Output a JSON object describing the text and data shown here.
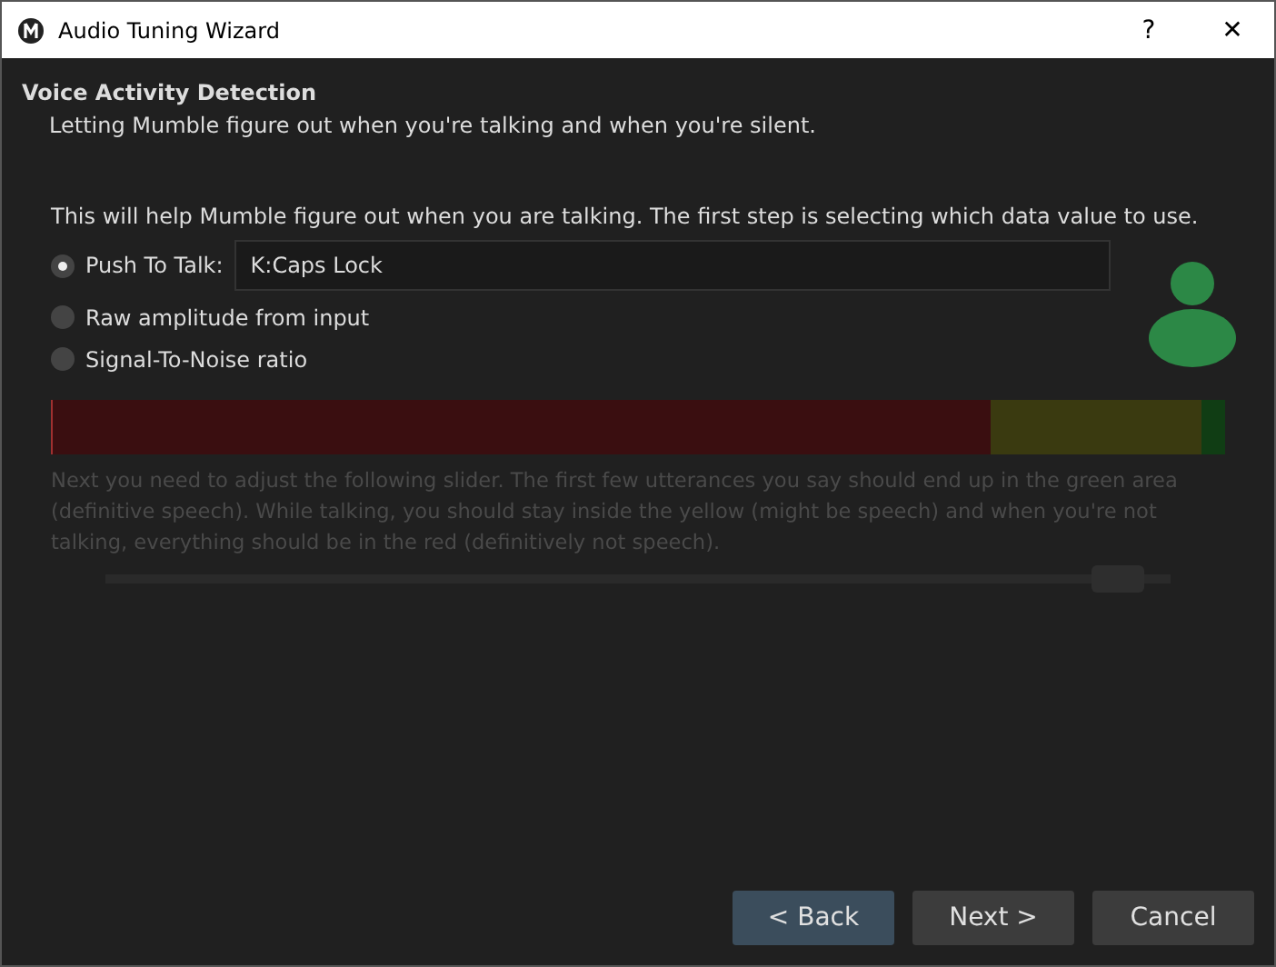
{
  "window": {
    "title": "Audio Tuning Wizard",
    "help": "?",
    "close": "✕"
  },
  "header": {
    "title": "Voice Activity Detection",
    "subtitle": "Letting Mumble figure out when you're talking and when you're silent."
  },
  "intro": "This will help Mumble figure out when you are talking. The first step is selecting which data value to use.",
  "options": [
    {
      "kind": "shortcut",
      "label": "Push To Talk:",
      "value": "K:Caps Lock",
      "selected": true
    },
    {
      "kind": "plain",
      "label": "Raw amplitude from input",
      "selected": false
    },
    {
      "kind": "plain",
      "label": "Signal-To-Noise ratio",
      "selected": false
    }
  ],
  "meter": {
    "zones": [
      {
        "kind": "maybe",
        "level": 0.98
      },
      {
        "kind": "silence",
        "level": 0.8
      }
    ]
  },
  "adjust": {
    "disabled": true,
    "text": "Next you need to adjust the following slider. The first few utterances you say should end up in the green area (definitive speech). While talking, you should stay inside the yellow (might be speech) and when you're not talking, everything should be in the red (definitively not speech).",
    "slider": {
      "level": 0.95
    }
  },
  "buttons": [
    {
      "label": "< Back",
      "selected": true
    },
    {
      "label": "Next >",
      "selected": false
    },
    {
      "label": "Cancel",
      "selected": false
    }
  ]
}
